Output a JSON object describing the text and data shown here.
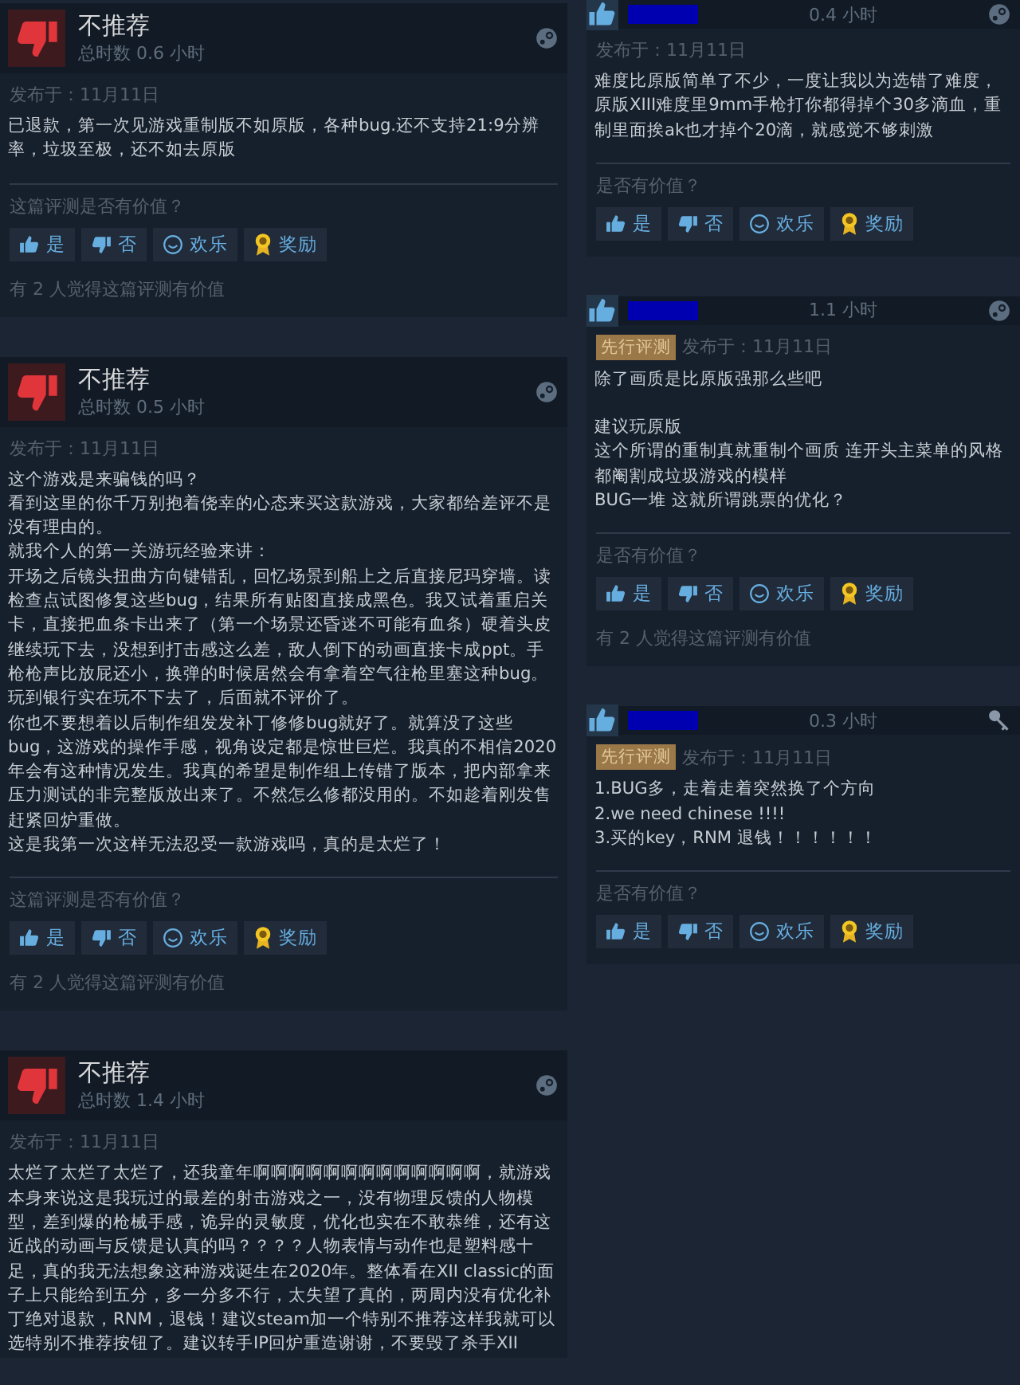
{
  "columns": [
    {
      "reviews": [
        {
          "kind": "full",
          "recommended": false,
          "verdict": "不推荐",
          "hours": "总时数 0.6 小时",
          "platform_icon": {
            "kind": "steam"
          },
          "posted": "发布于：11月11日",
          "body": [
            [
              "已退款，第一次见游戏重制版不如原版，各种bug.还不支持21:9分辨率，垃圾至极，还不如去原版"
            ]
          ],
          "helpful_prompt": "这篇评测是否有价值？",
          "buttons": [
            {
              "kind": "yes",
              "label": "是"
            },
            {
              "kind": "no",
              "label": "否"
            },
            {
              "kind": "funny",
              "label": "欢乐"
            },
            {
              "kind": "award",
              "label": "奖励"
            }
          ],
          "helpful_count": "有 2 人觉得这篇评测有价值"
        },
        {
          "kind": "full",
          "recommended": false,
          "verdict": "不推荐",
          "hours": "总时数 0.5 小时",
          "platform_icon": {
            "kind": "steam"
          },
          "posted": "发布于：11月11日",
          "body": [
            [
              "这个游戏是来骗钱的吗？",
              "看到这里的你千万别抱着侥幸的心态来买这款游戏，大家都给差评不是没有理由的。",
              "就我个人的第一关游玩经验来讲：",
              "开场之后镜头扭曲方向键错乱，回忆场景到船上之后直接尼玛穿墙。读检查点试图修复这些bug，结果所有贴图直接成黑色。我又试着重启关卡，直接把血条卡出来了（第一个场景还昏迷不可能有血条）硬着头皮继续玩下去，没想到打击感这么差，敌人倒下的动画直接卡成ppt。手枪枪声比放屁还小，换弹的时候居然会有拿着空气往枪里塞这种bug。玩到银行实在玩不下去了，后面就不评价了。",
              "你也不要想着以后制作组发发补丁修修bug就好了。就算没了这些bug，这游戏的操作手感，视角设定都是惊世巨烂。我真的不相信2020年会有这种情况发生。我真的希望是制作组上传错了版本，把内部拿来压力测试的非完整版放出来了。不然怎么修都没用的。不如趁着刚发售赶紧回炉重做。",
              "这是我第一次这样无法忍受一款游戏吗，真的是太烂了！"
            ]
          ],
          "helpful_prompt": "这篇评测是否有价值？",
          "buttons": [
            {
              "kind": "yes",
              "label": "是"
            },
            {
              "kind": "no",
              "label": "否"
            },
            {
              "kind": "funny",
              "label": "欢乐"
            },
            {
              "kind": "award",
              "label": "奖励"
            }
          ],
          "helpful_count": "有 2 人觉得这篇评测有价值"
        },
        {
          "kind": "full",
          "recommended": false,
          "verdict": "不推荐",
          "hours": "总时数 1.4 小时",
          "platform_icon": {
            "kind": "steam"
          },
          "posted": "发布于：11月11日",
          "body": [
            [
              "太烂了太烂了太烂了，还我童年啊啊啊啊啊啊啊啊啊啊啊啊啊，就游戏本身来说这是我玩过的最差的射击游戏之一，没有物理反馈的人物模型，差到爆的枪械手感，诡异的灵敏度，优化也实在不敢恭维，还有这近战的动画与反馈是认真的吗？？？？人物表情与动作也是塑料感十足，真的我无法想象这种游戏诞生在2020年。整体看在XII classic的面子上只能给到五分，多一分多不行，太失望了真的，两周内没有优化补丁绝对退款，RNM，退钱！建议steam加一个特别不推荐这样我就可以选特别不推荐按钮了。建议转手IP回炉重造谢谢，不要毁了杀手XII"
            ]
          ]
        }
      ]
    },
    {
      "reviews": [
        {
          "kind": "compact",
          "recommended": true,
          "hours": "0.4 小时",
          "platform_icon": {
            "kind": "steam"
          },
          "posted": "发布于：11月11日",
          "body": [
            [
              "难度比原版简单了不少，一度让我以为选错了难度，原版XIII难度里9mm手枪打你都得掉个30多滴血，重制里面挨ak也才掉个20滴，就感觉不够刺激"
            ]
          ],
          "helpful_prompt": "是否有价值？",
          "buttons": [
            {
              "kind": "yes",
              "label": "是"
            },
            {
              "kind": "no",
              "label": "否"
            },
            {
              "kind": "funny",
              "label": "欢乐"
            },
            {
              "kind": "award",
              "label": "奖励"
            }
          ]
        },
        {
          "kind": "compact",
          "recommended": true,
          "hours": "1.1 小时",
          "platform_icon": {
            "kind": "steam"
          },
          "early_access": "先行评测",
          "posted": "发布于：11月11日",
          "body": [
            [
              "除了画质是比原版强那么些吧"
            ],
            [
              "建议玩原版",
              "这个所谓的重制真就重制个画质 连开头主菜单的风格都阉割成垃圾游戏的模样",
              "BUG一堆 这就所谓跳票的优化？"
            ]
          ],
          "helpful_prompt": "是否有价值？",
          "buttons": [
            {
              "kind": "yes",
              "label": "是"
            },
            {
              "kind": "no",
              "label": "否"
            },
            {
              "kind": "funny",
              "label": "欢乐"
            },
            {
              "kind": "award",
              "label": "奖励"
            }
          ],
          "helpful_count": "有 2 人觉得这篇评测有价值"
        },
        {
          "kind": "compact",
          "recommended": true,
          "hours": "0.3 小时",
          "platform_icon": {
            "kind": "key"
          },
          "early_access": "先行评测",
          "posted": "发布于：11月11日",
          "body": [
            [
              "1.BUG多，走着走着突然换了个方向",
              "2.we need chinese !!!!",
              "3.买的key，RNM 退钱！！！！！！"
            ]
          ],
          "helpful_prompt": "是否有价值？",
          "buttons": [
            {
              "kind": "yes",
              "label": "是"
            },
            {
              "kind": "no",
              "label": "否"
            },
            {
              "kind": "funny",
              "label": "欢乐"
            },
            {
              "kind": "award",
              "label": "奖励"
            }
          ]
        }
      ]
    }
  ]
}
